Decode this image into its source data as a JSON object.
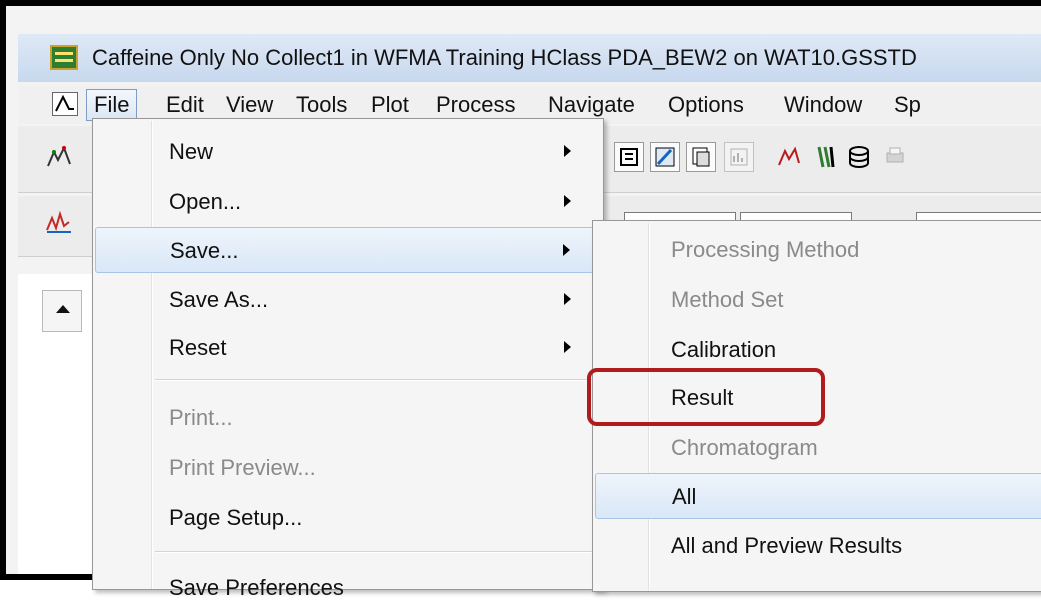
{
  "window": {
    "title": "Caffeine Only No Collect1 in WFMA Training HClass PDA_BEW2 on WAT10.GSSTD"
  },
  "menubar": {
    "items": [
      {
        "label": "File"
      },
      {
        "label": "Edit"
      },
      {
        "label": "View"
      },
      {
        "label": "Tools"
      },
      {
        "label": "Plot"
      },
      {
        "label": "Process"
      },
      {
        "label": "Navigate"
      },
      {
        "label": "Options"
      },
      {
        "label": "Window"
      },
      {
        "label": "Sp"
      }
    ],
    "active": "File"
  },
  "file_menu": {
    "items": [
      {
        "label": "New",
        "submenu": true,
        "enabled": true
      },
      {
        "label": "Open...",
        "submenu": true,
        "enabled": true
      },
      {
        "label": "Save...",
        "submenu": true,
        "enabled": true,
        "selected": true
      },
      {
        "label": "Save As...",
        "submenu": true,
        "enabled": true
      },
      {
        "label": "Reset",
        "submenu": true,
        "enabled": true
      },
      {
        "label": "Print...",
        "submenu": false,
        "enabled": false
      },
      {
        "label": "Print Preview...",
        "submenu": false,
        "enabled": false
      },
      {
        "label": "Page Setup...",
        "submenu": false,
        "enabled": true
      },
      {
        "label": "Save Preferences",
        "submenu": false,
        "enabled": true
      }
    ]
  },
  "save_submenu": {
    "items": [
      {
        "label": "Processing Method",
        "enabled": false
      },
      {
        "label": "Method Set",
        "enabled": false
      },
      {
        "label": "Calibration",
        "enabled": true
      },
      {
        "label": "Result",
        "enabled": true,
        "highlighted": true
      },
      {
        "label": "Chromatogram",
        "enabled": false
      },
      {
        "label": "All",
        "enabled": true,
        "selected": true
      },
      {
        "label": "All and Preview Results",
        "enabled": true
      }
    ]
  },
  "toolbar": {
    "icons": [
      "peak-detect-icon",
      "chromatogram-icon",
      "table-icon",
      "integrate-icon",
      "copy-icon",
      "report-icon",
      "fit-icon",
      "vial-icon",
      "database-icon",
      "print-icon"
    ]
  },
  "colors": {
    "highlight_border": "#b01c1c",
    "selection": "#d9e7f7",
    "disabled_text": "#8a8a8a"
  }
}
